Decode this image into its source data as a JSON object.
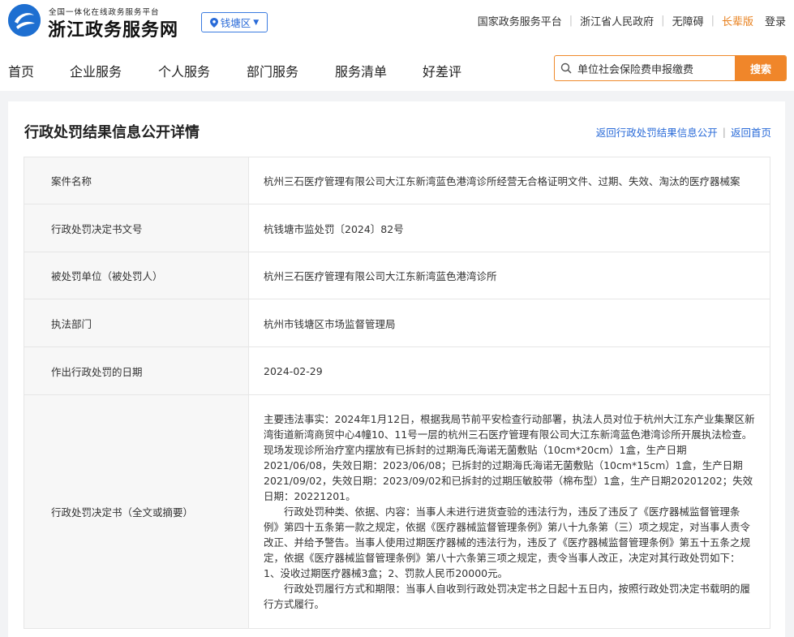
{
  "header": {
    "platform_sub": "全国一体化在线政务服务平台",
    "brand_title": "浙江政务服务网",
    "region": "钱塘区",
    "top_links": [
      "国家政务服务平台",
      "浙江省人民政府",
      "无障碍",
      "长辈版"
    ],
    "login": "登录",
    "elder_color": "#e8801d"
  },
  "nav": {
    "items": [
      "首页",
      "企业服务",
      "个人服务",
      "部门服务",
      "服务清单",
      "好差评"
    ]
  },
  "search": {
    "value": "单位社会保险费申报缴费",
    "button": "搜索"
  },
  "page": {
    "title": "行政处罚结果信息公开详情",
    "back_list": "返回行政处罚结果信息公开",
    "back_home": "返回首页"
  },
  "rows": [
    {
      "label": "案件名称",
      "value": "杭州三石医疗管理有限公司大江东新湾蓝色港湾诊所经营无合格证明文件、过期、失效、淘汰的医疗器械案"
    },
    {
      "label": "行政处罚决定书文号",
      "value": "杭钱塘市监处罚〔2024〕82号"
    },
    {
      "label": "被处罚单位（被处罚人）",
      "value": "杭州三石医疗管理有限公司大江东新湾蓝色港湾诊所"
    },
    {
      "label": "执法部门",
      "value": "杭州市钱塘区市场监督管理局"
    },
    {
      "label": "作出行政处罚的日期",
      "value": "2024-02-29"
    }
  ],
  "decision": {
    "label": "行政处罚决定书（全文或摘要）",
    "paragraphs": [
      "主要违法事实：2024年1月12日，根据我局节前平安检查行动部署，执法人员对位于杭州大江东产业集聚区新湾街道新湾商贸中心4幢10、11号一层的杭州三石医疗管理有限公司大江东新湾蓝色港湾诊所开展执法检查。现场发现诊所治疗室内摆放有已拆封的过期海氏海诺无菌敷贴（10cm*20cm）1盒，生产日期2021/06/08，失效日期：2023/06/08；已拆封的过期海氏海诺无菌敷贴（10cm*15cm）1盒，生产日期2021/09/02，失效日期：2023/09/02和已拆封的过期压敏胶带（棉布型）1盒，生产日期20201202；失效日期：20221201。",
      "　　行政处罚种类、依据、内容：当事人未进行进货查验的违法行为，违反了违反了《医疗器械监督管理条例》第四十五条第一款之规定，依据《医疗器械监督管理条例》第八十九条第（三）项之规定，对当事人责令改正、并给予警告。当事人使用过期医疗器械的违法行为，违反了《医疗器械监督管理条例》第五十五条之规定，依据《医疗器械监督管理条例》第八十六条第三项之规定，责令当事人改正，决定对其行政处罚如下：1、没收过期医疗器械3盒；2、罚款人民币20000元。",
      "　　行政处罚履行方式和期限：当事人自收到行政处罚决定书之日起十五日内，按照行政处罚决定书载明的履行方式履行。"
    ]
  },
  "colors": {
    "accent_blue": "#2a6bd8",
    "search_orange": "#f0862a"
  },
  "icons": {
    "logo": "zhejiang-logo-icon",
    "region_pin": "location-pin-icon",
    "region_caret": "caret-down-icon",
    "search": "search-icon"
  }
}
